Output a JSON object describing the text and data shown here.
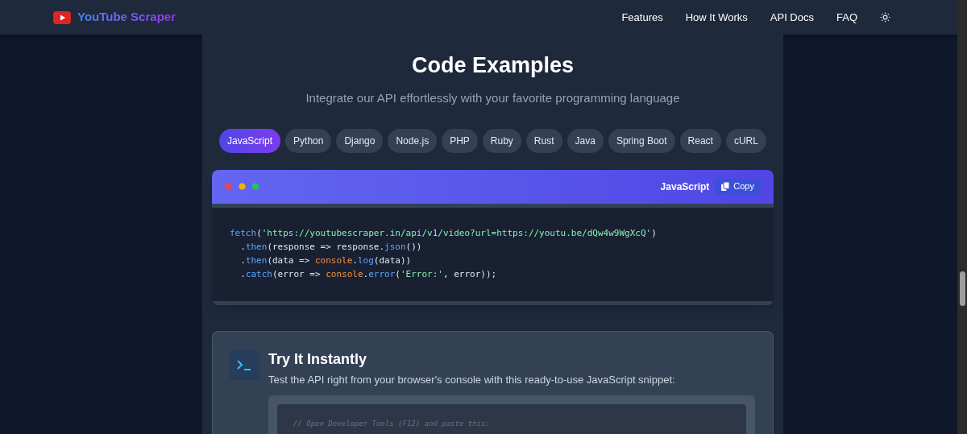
{
  "nav": {
    "brand": "YouTube Scraper",
    "links": [
      "Features",
      "How It Works",
      "API Docs",
      "FAQ"
    ]
  },
  "section": {
    "title": "Code Examples",
    "subtitle": "Integrate our API effortlessly with your favorite programming language"
  },
  "tabs": [
    {
      "label": "JavaScript",
      "selected": true
    },
    {
      "label": "Python",
      "selected": false
    },
    {
      "label": "Django",
      "selected": false
    },
    {
      "label": "Node.js",
      "selected": false
    },
    {
      "label": "PHP",
      "selected": false
    },
    {
      "label": "Ruby",
      "selected": false
    },
    {
      "label": "Rust",
      "selected": false
    },
    {
      "label": "Java",
      "selected": false
    },
    {
      "label": "Spring Boot",
      "selected": false
    },
    {
      "label": "React",
      "selected": false
    },
    {
      "label": "cURL",
      "selected": false
    }
  ],
  "code_window": {
    "language": "JavaScript",
    "copy_button": "Copy",
    "lines": [
      [
        {
          "kind": "fn",
          "text": "fetch"
        },
        {
          "kind": "plain",
          "text": "("
        },
        {
          "kind": "str",
          "text": "'https://youtubescraper.in/api/v1/video?url=https://youtu.be/dQw4w9WgXcQ'"
        },
        {
          "kind": "plain",
          "text": ")"
        }
      ],
      [
        {
          "kind": "plain",
          "text": "  ."
        },
        {
          "kind": "fn",
          "text": "then"
        },
        {
          "kind": "plain",
          "text": "(response => response."
        },
        {
          "kind": "fn",
          "text": "json"
        },
        {
          "kind": "plain",
          "text": "())"
        }
      ],
      [
        {
          "kind": "plain",
          "text": "  ."
        },
        {
          "kind": "fn",
          "text": "then"
        },
        {
          "kind": "plain",
          "text": "(data => "
        },
        {
          "kind": "obj",
          "text": "console"
        },
        {
          "kind": "plain",
          "text": "."
        },
        {
          "kind": "fn",
          "text": "log"
        },
        {
          "kind": "plain",
          "text": "(data))"
        }
      ],
      [
        {
          "kind": "plain",
          "text": "  ."
        },
        {
          "kind": "fn",
          "text": "catch"
        },
        {
          "kind": "plain",
          "text": "(error => "
        },
        {
          "kind": "obj",
          "text": "console"
        },
        {
          "kind": "plain",
          "text": "."
        },
        {
          "kind": "fn",
          "text": "error"
        },
        {
          "kind": "plain",
          "text": "("
        },
        {
          "kind": "str",
          "text": "'Error:'"
        },
        {
          "kind": "plain",
          "text": ", error));"
        }
      ]
    ]
  },
  "try_card": {
    "title": "Try It Instantly",
    "description": "Test the API right from your browser's console with this ready-to-use JavaScript snippet:",
    "code_comment": "// Open Developer Tools (F12) and paste this:"
  }
}
